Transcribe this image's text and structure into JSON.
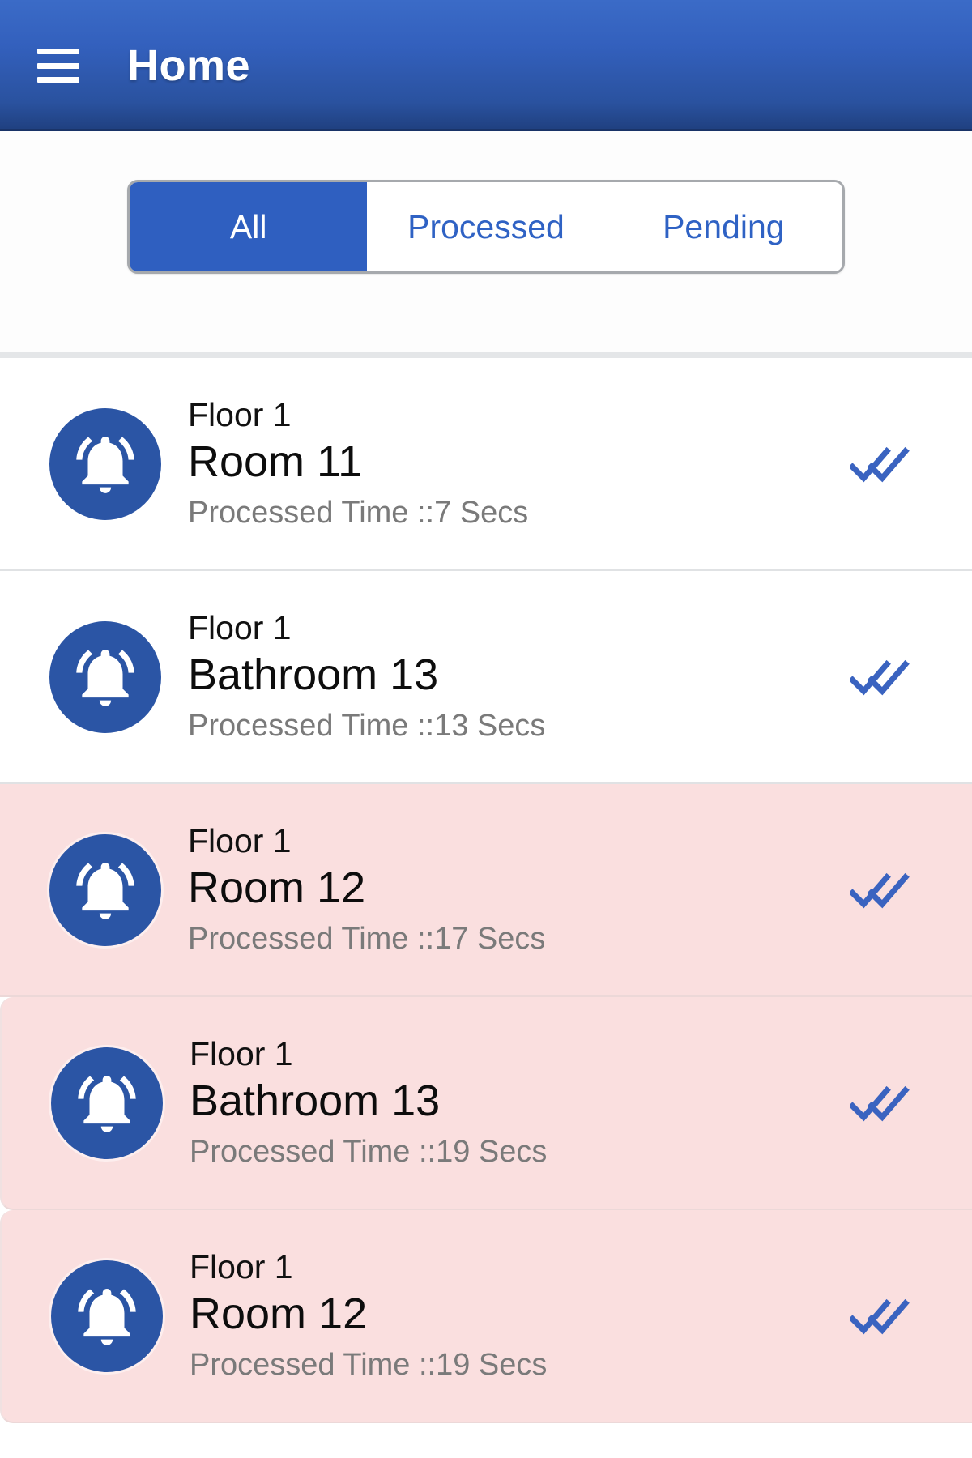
{
  "appbar": {
    "menu_icon": "hamburger-menu-icon",
    "title": "Home"
  },
  "filter": {
    "segments": [
      {
        "label": "All",
        "selected": true
      },
      {
        "label": "Processed",
        "selected": false
      },
      {
        "label": "Pending",
        "selected": false
      }
    ]
  },
  "colors": {
    "appbar_blue": "#3360bd",
    "accent_blue": "#2f5fc0",
    "icon_blue": "#2b55a5",
    "check_blue": "#3a63c0",
    "alert_pink": "#fadfdf",
    "muted_text": "#7a7a7a"
  },
  "list": {
    "rows": [
      {
        "icon": "alarm-bell-icon",
        "floor": "Floor 1",
        "room": "Room 11",
        "time": "Processed Time ::7 Secs",
        "status_icon": "double-check-icon",
        "alert": false
      },
      {
        "icon": "alarm-bell-icon",
        "floor": "Floor 1",
        "room": "Bathroom 13",
        "time": "Processed Time ::13 Secs",
        "status_icon": "double-check-icon",
        "alert": false
      },
      {
        "icon": "alarm-bell-icon",
        "floor": "Floor 1",
        "room": "Room 12",
        "time": "Processed Time ::17 Secs",
        "status_icon": "double-check-icon",
        "alert": true
      },
      {
        "icon": "alarm-bell-icon",
        "floor": "Floor 1",
        "room": "Bathroom 13",
        "time": "Processed Time ::19 Secs",
        "status_icon": "double-check-icon",
        "alert": true
      },
      {
        "icon": "alarm-bell-icon",
        "floor": "Floor 1",
        "room": "Room 12",
        "time": "Processed Time ::19 Secs",
        "status_icon": "double-check-icon",
        "alert": true
      }
    ]
  }
}
